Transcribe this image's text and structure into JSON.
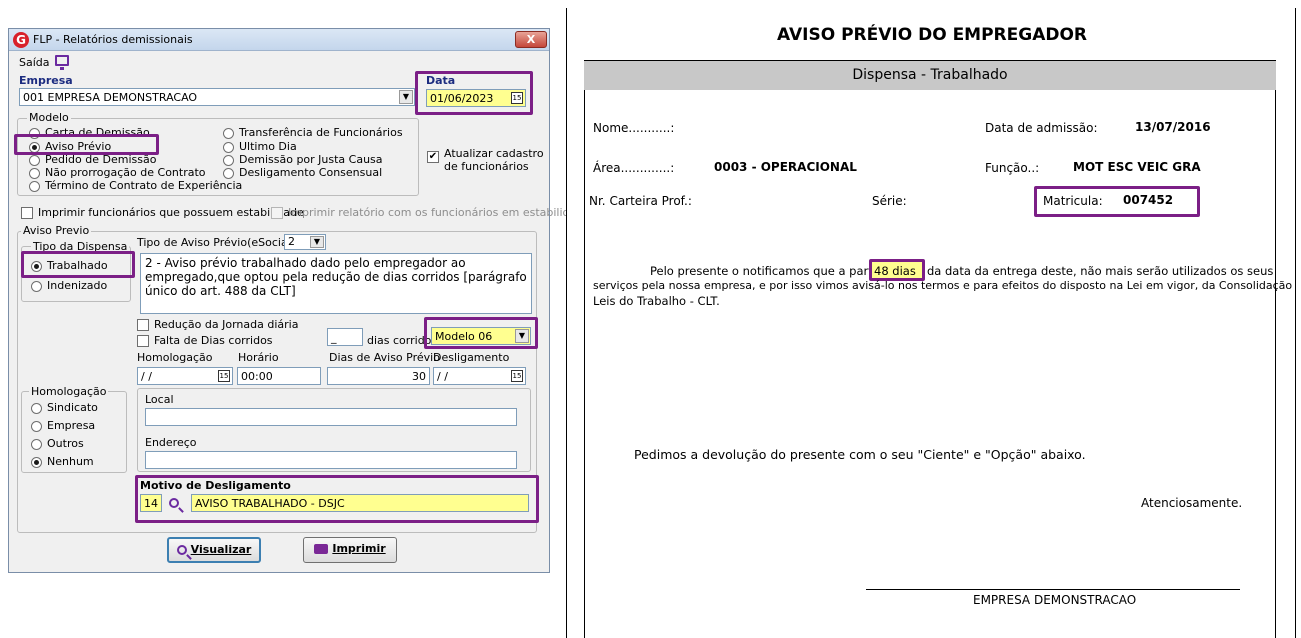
{
  "window": {
    "title": "FLP - Relatórios demissionais",
    "close_label": "X",
    "app_icon": "G"
  },
  "menu": {
    "saida": "Saída"
  },
  "empresa": {
    "label": "Empresa",
    "value": "001 EMPRESA DEMONSTRACAO"
  },
  "data": {
    "label": "Data",
    "value": "01/06/2023"
  },
  "modelo": {
    "title": "Modelo",
    "options": [
      "Carta de Demissão",
      "Aviso Prévio",
      "Pedido de Demissão",
      "Não prorrogação de Contrato",
      "Término de Contrato de Experiência",
      "Transferência de Funcionários",
      "Ultimo Dia",
      "Demissão por Justa Causa",
      "Desligamento Consensual"
    ],
    "selected": "Aviso Prévio",
    "atualizar_line1": "Atualizar cadastro",
    "atualizar_line2": "de funcionários"
  },
  "estabilidade": {
    "imprimir_func": "Imprimir funcionários que possuem estabilidade",
    "imprimir_rel": "Imprimir relatório com os funcionários em estabilidade"
  },
  "aviso_previo": {
    "title": "Aviso Previo",
    "tipo_dispensa_title": "Tipo da Dispensa",
    "trabalhado": "Trabalhado",
    "indenizado": "Indenizado",
    "tipo_esocial_label": "Tipo de Aviso Prévio(eSocial):",
    "tipo_esocial_value": "2",
    "descricao": "2 - Aviso prévio trabalhado dado pelo empregador ao empregado,que optou pela redução de dias corridos [parágrafo único do art. 488 da CLT]",
    "reducao": "Redução da Jornada diária",
    "falta": "Falta de Dias corridos",
    "dias_corridos_value": "_",
    "dias_corridos_label": "dias corridos",
    "modelo_value": "Modelo 06",
    "homologacao_label": "Homologação",
    "horario_label": "Horário",
    "dias_aviso_label": "Dias de Aviso Prévio",
    "desligamento_label": "Desligamento",
    "homologacao_value": "/ /",
    "horario_value": "00:00",
    "dias_aviso_value": "30",
    "desligamento_value": "/ /"
  },
  "homologacao": {
    "title": "Homologação",
    "options": [
      "Sindicato",
      "Empresa",
      "Outros",
      "Nenhum"
    ],
    "selected": "Nenhum",
    "local_label": "Local",
    "endereco_label": "Endereço"
  },
  "motivo": {
    "label": "Motivo de Desligamento",
    "code": "14",
    "desc": "AVISO TRABALHADO - DSJC"
  },
  "buttons": {
    "visualizar": "Visualizar",
    "imprimir": "Imprimir"
  },
  "document": {
    "title": "AVISO PRÉVIO DO EMPREGADOR",
    "band": "Dispensa  -  Trabalhado",
    "nome_label": "Nome...........:",
    "admissao_label": "Data de admissão:",
    "admissao_value": "13/07/2016",
    "area_label": "Área.............:",
    "area_value": "0003 -  OPERACIONAL",
    "funcao_label": "Função..:",
    "funcao_value": "MOT ESC VEIC GRA",
    "carteira_label": "Nr. Carteira Prof.:",
    "serie_label": "Série:",
    "matricula_label": "Matricula:",
    "matricula_value": "007452",
    "para1_before": "Pelo presente o notificamos que a partir de",
    "para1_days": "48 dias",
    "para1_after": "da data da entrega  deste, não mais serão utilizados os seus",
    "para1_line2": "serviços pela nossa empresa, e por isso vimos avisá-lo nos termos e para efeitos do disposto na Lei em vigor, da Consolidação",
    "para1_line3": "Leis do Trabalho - CLT.",
    "para2": "Pedimos a  devolução  do presente com o seu \"Ciente\" e \"Opção\"   abaixo.",
    "atenciosamente": "Atenciosamente.",
    "signature": "EMPRESA DEMONSTRACAO"
  },
  "colors": {
    "highlight": "#7b1f86",
    "yellow": "#ffff90",
    "label_blue": "#1c2c80"
  }
}
